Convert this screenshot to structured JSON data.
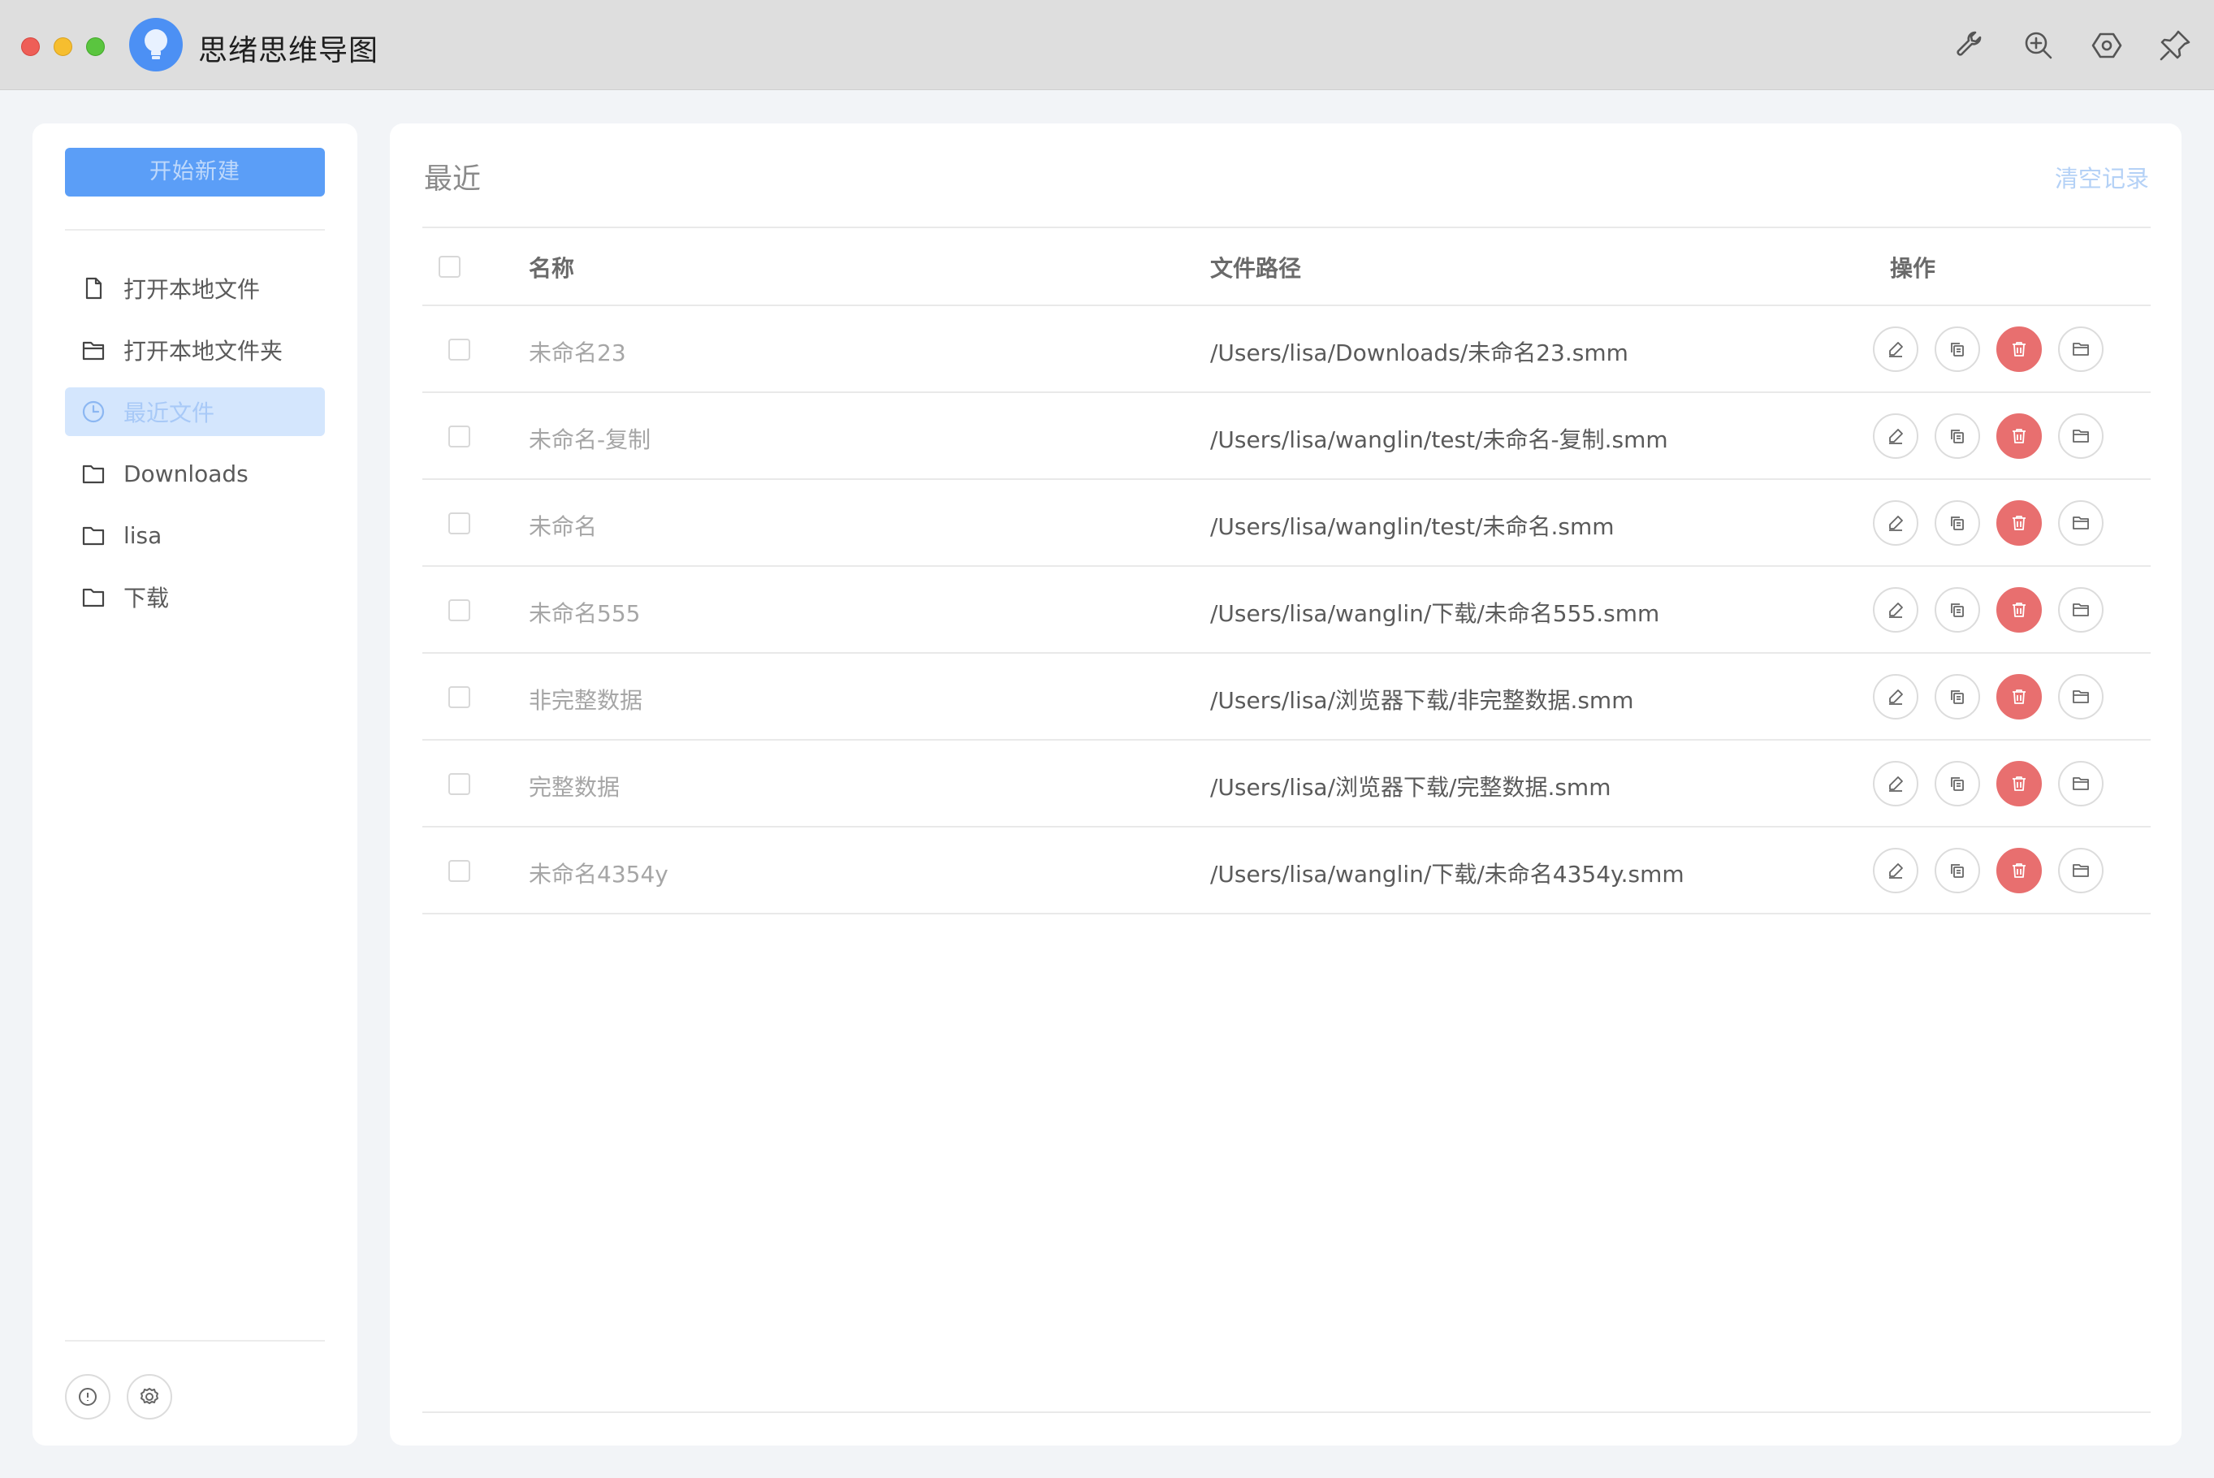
{
  "app": {
    "title": "思绪思维导图"
  },
  "titlebar_tools": [
    {
      "name": "wrench-icon"
    },
    {
      "name": "zoom-in-icon"
    },
    {
      "name": "hexagon-settings-icon"
    },
    {
      "name": "pin-icon"
    }
  ],
  "sidebar": {
    "new_button": "开始新建",
    "items": [
      {
        "label": "打开本地文件",
        "icon": "file-icon"
      },
      {
        "label": "打开本地文件夹",
        "icon": "folder-open-icon"
      },
      {
        "label": "最近文件",
        "icon": "clock-icon",
        "active": true
      },
      {
        "label": "Downloads",
        "icon": "folder-icon"
      },
      {
        "label": "lisa",
        "icon": "folder-icon"
      },
      {
        "label": "下载",
        "icon": "folder-icon"
      }
    ],
    "footer_buttons": [
      "info-icon",
      "settings-gear-icon"
    ]
  },
  "main": {
    "title": "最近",
    "clear_label": "清空记录",
    "columns": {
      "name": "名称",
      "path": "文件路径",
      "actions": "操作"
    },
    "rows": [
      {
        "name": "未命名23",
        "path": "/Users/lisa/Downloads/未命名23.smm"
      },
      {
        "name": "未命名-复制",
        "path": "/Users/lisa/wanglin/test/未命名-复制.smm"
      },
      {
        "name": "未命名",
        "path": "/Users/lisa/wanglin/test/未命名.smm"
      },
      {
        "name": "未命名555",
        "path": "/Users/lisa/wanglin/下载/未命名555.smm"
      },
      {
        "name": "非完整数据",
        "path": "/Users/lisa/浏览器下载/非完整数据.smm"
      },
      {
        "name": "完整数据",
        "path": "/Users/lisa/浏览器下载/完整数据.smm"
      },
      {
        "name": "未命名4354y",
        "path": "/Users/lisa/wanglin/下载/未命名4354y.smm"
      }
    ],
    "row_actions": [
      "edit-icon",
      "copy-icon",
      "delete-icon",
      "folder-icon"
    ]
  },
  "colors": {
    "accent": "#5b9ef7",
    "danger": "#e86f6f",
    "active_bg": "#d4e6fd"
  }
}
